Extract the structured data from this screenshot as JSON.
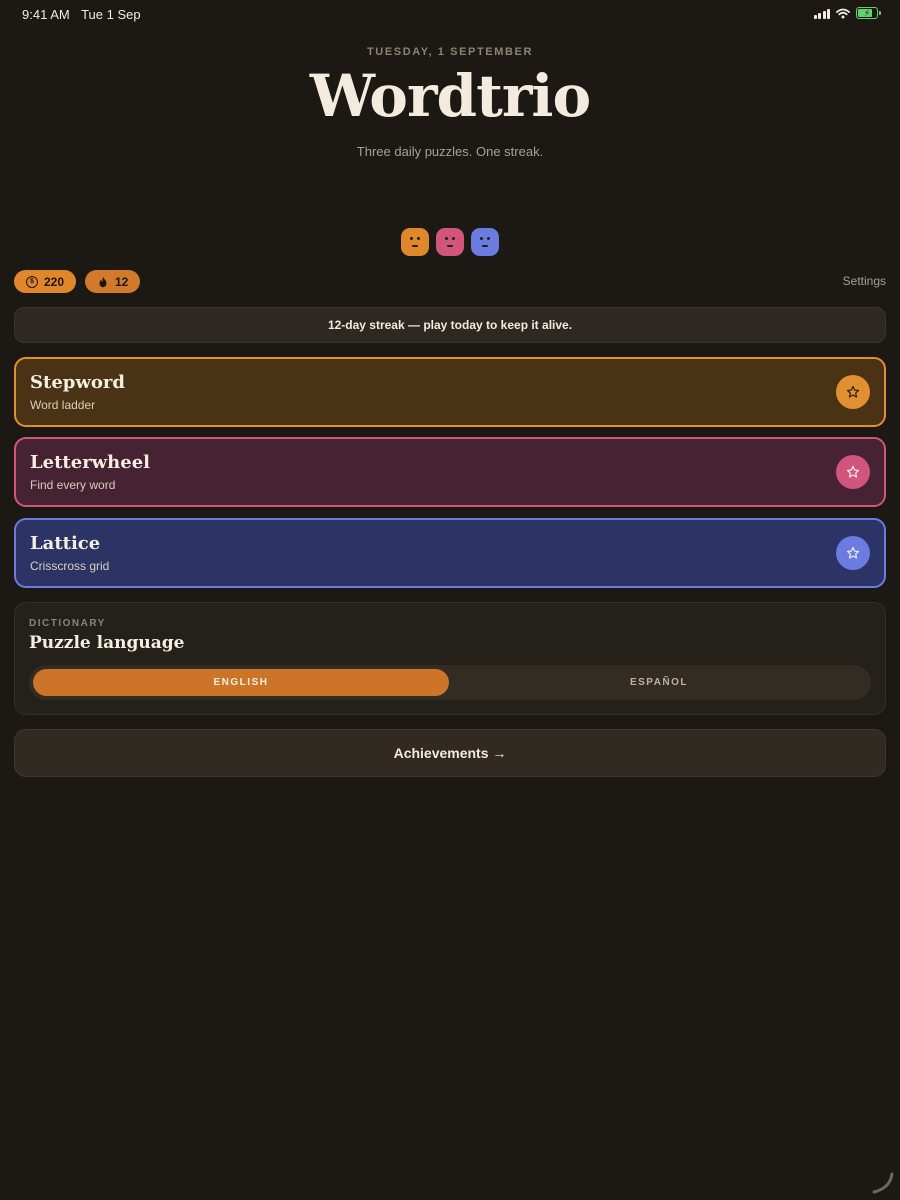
{
  "status_bar": {
    "time": "9:41 AM",
    "date": "Tue 1 Sep"
  },
  "header": {
    "date_line": "TUESDAY, 1 SEPTEMBER",
    "title": "Wordtrio",
    "subtitle": "Three daily puzzles. One streak."
  },
  "mascots": [
    {
      "name": "orange-mascot-icon",
      "color": "#e0872c"
    },
    {
      "name": "pink-mascot-icon",
      "color": "#d1557c"
    },
    {
      "name": "blue-mascot-icon",
      "color": "#6b7be0"
    }
  ],
  "stats": {
    "coins": "220",
    "streak": "12",
    "settings_label": "Settings"
  },
  "banner": {
    "text": "12-day streak — play today to keep it alive."
  },
  "games": [
    {
      "name": "Stepword",
      "description": "Word ladder",
      "icon": "star-icon",
      "accent": "#e2902f"
    },
    {
      "name": "Letterwheel",
      "description": "Find every word",
      "icon": "star-icon",
      "accent": "#d1557c"
    },
    {
      "name": "Lattice",
      "description": "Crisscross grid",
      "icon": "star-icon",
      "accent": "#6b7be0"
    }
  ],
  "dictionary": {
    "label": "DICTIONARY",
    "title": "Puzzle language",
    "options": [
      "ENGLISH",
      "ESPAÑOL"
    ],
    "selected": "ENGLISH"
  },
  "achievements": {
    "label": "Achievements →"
  }
}
